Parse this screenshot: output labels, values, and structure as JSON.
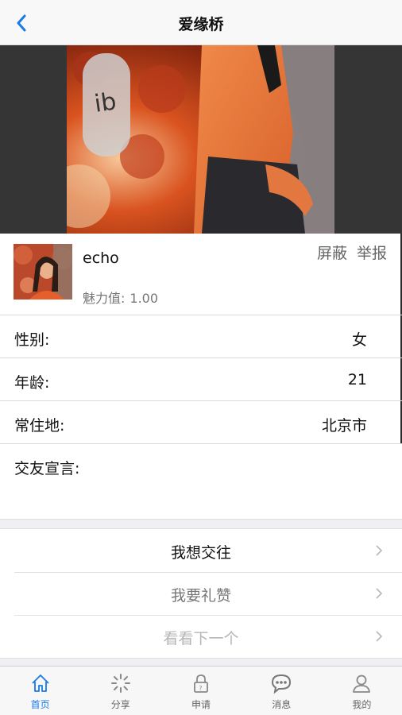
{
  "nav": {
    "title": "爱缘桥"
  },
  "profile": {
    "name": "echo",
    "charm_label": "魅力值:",
    "charm_value": "1.00",
    "block_label": "屏蔽",
    "report_label": "举报"
  },
  "info": {
    "gender_label": "性别:",
    "gender_value": "女",
    "age_label": "年龄:",
    "age_value": "21",
    "residence_label": "常住地:",
    "residence_value": "北京市",
    "declaration_label": "交友宣言:"
  },
  "actions": [
    {
      "label": "我想交往"
    },
    {
      "label": "我要礼赞"
    },
    {
      "label": "看看下一个"
    }
  ],
  "tabs": [
    {
      "label": "首页",
      "icon": "home-icon",
      "active": true
    },
    {
      "label": "分享",
      "icon": "share-icon",
      "active": false
    },
    {
      "label": "申请",
      "icon": "lock-icon",
      "active": false
    },
    {
      "label": "消息",
      "icon": "message-icon",
      "active": false
    },
    {
      "label": "我的",
      "icon": "user-icon",
      "active": false
    }
  ],
  "colors": {
    "accent": "#1a7ae6",
    "hero_background": "#353535",
    "photo_orange": "#e0552a"
  }
}
